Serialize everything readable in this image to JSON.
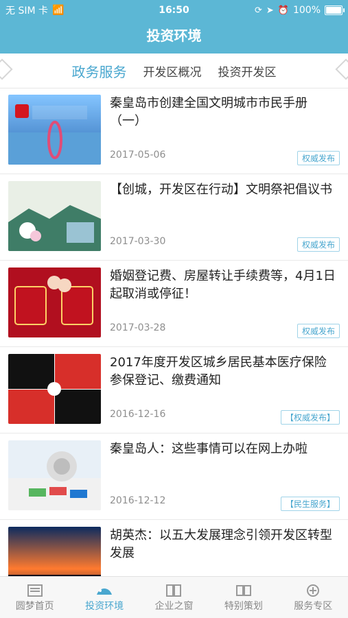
{
  "statusbar": {
    "carrier": "无 SIM 卡",
    "time": "16:50",
    "battery": "100%"
  },
  "header": {
    "title": "投资环境"
  },
  "tabs": [
    {
      "label": "政务服务",
      "active": true
    },
    {
      "label": "开发区概况",
      "active": false
    },
    {
      "label": "投资开发区",
      "active": false
    }
  ],
  "news": [
    {
      "title": "秦皇岛市创建全国文明城市市民手册（一）",
      "date": "2017-05-06",
      "tag": "权威发布",
      "image": "city-reflection-photo"
    },
    {
      "title": "【创城，开发区在行动】文明祭祀倡议书",
      "date": "2017-03-30",
      "tag": "权威发布",
      "image": "flowers-and-mountains-photo"
    },
    {
      "title": "婚姻登记费、房屋转让手续费等，4月1日起取消或停征！",
      "date": "2017-03-28",
      "tag": "权威发布",
      "image": "marriage-certificate-photo"
    },
    {
      "title": "2017年度开发区城乡居民基本医疗保险参保登记、缴费通知",
      "date": "2016-12-16",
      "tag": "【权威发布】",
      "image": "puzzle-medical-insurance-photo"
    },
    {
      "title": "秦皇岛人：这些事情可以在网上办啦",
      "date": "2016-12-12",
      "tag": "【民生服务】",
      "image": "email-at-keyboard-photo"
    },
    {
      "title": "胡英杰：以五大发展理念引领开发区转型发展",
      "date": "",
      "tag": "",
      "image": "sunset-skyline-photo"
    }
  ],
  "bottom_nav": [
    {
      "label": "圆梦首页",
      "active": false
    },
    {
      "label": "投资环境",
      "active": true
    },
    {
      "label": "企业之窗",
      "active": false
    },
    {
      "label": "特别策划",
      "active": false
    },
    {
      "label": "服务专区",
      "active": false
    }
  ],
  "colors": {
    "header": "#5cb7d5",
    "accent": "#49a7cf"
  }
}
